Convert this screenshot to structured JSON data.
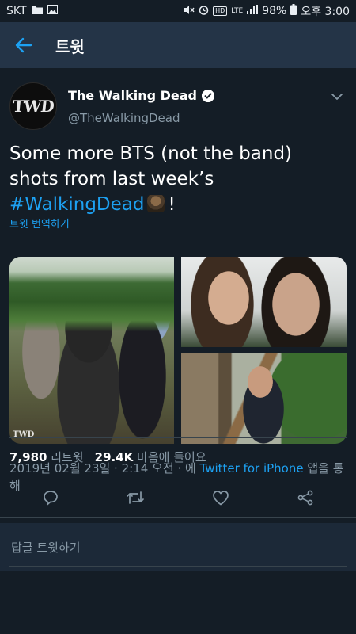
{
  "status_bar": {
    "carrier": "SKT",
    "battery": "98%",
    "time": "오후 3:00",
    "network": "LTE",
    "hd_voice": "HD"
  },
  "app_bar": {
    "title": "트윗"
  },
  "tweet": {
    "author_name": "The Walking Dead",
    "author_handle": "@TheWalkingDead",
    "avatar_text": "TWD",
    "text_before": "Some more BTS (not the band) shots from last week’s ",
    "hashtag": "#WalkingDead",
    "text_after": "!",
    "translate_label": "트윗 번역하기",
    "media_watermark": "TWD",
    "date_text": "2019년 02월 23일 · 2:14 오전 · 에 ",
    "via_text": "Twitter for iPhone",
    "after_via": " 앱을 통해",
    "retweet_count": "7,980",
    "retweet_label": "리트윗",
    "like_count": "29.4K",
    "like_label": "마음에 들어요"
  },
  "reply": {
    "placeholder": "답글 트윗하기"
  },
  "colors": {
    "background": "#141d26",
    "app_bar": "#243447",
    "accent": "#1da1f2",
    "muted": "#8899a6",
    "divider": "#38444d"
  }
}
